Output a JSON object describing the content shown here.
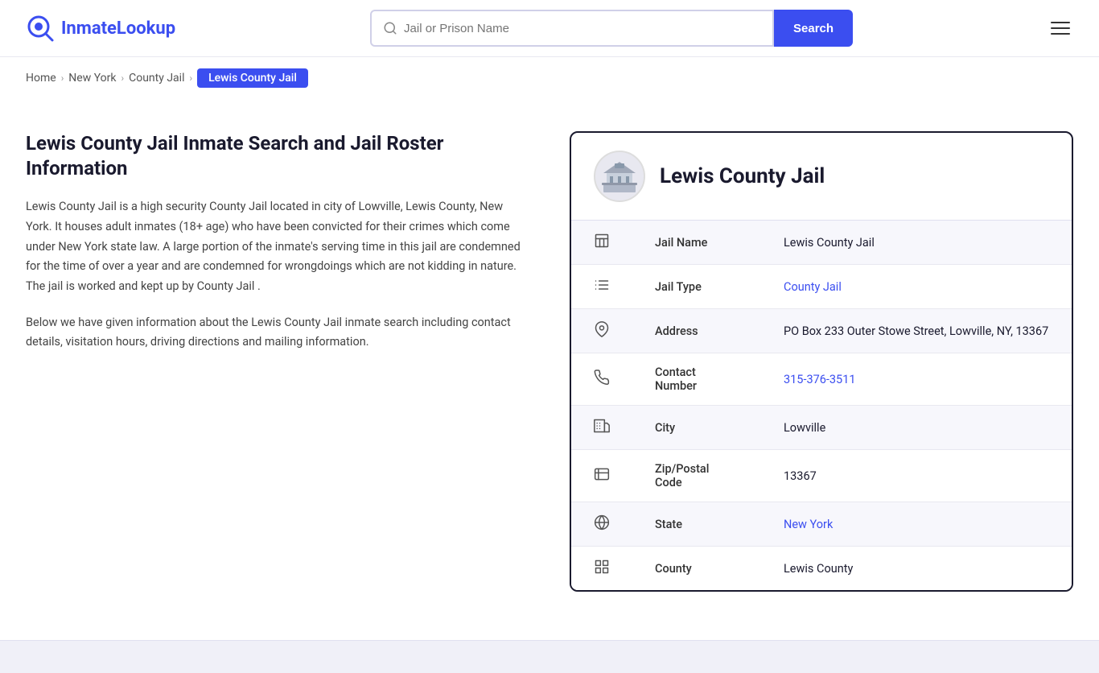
{
  "logo": {
    "prefix": "Inmate",
    "suffix": "Lookup"
  },
  "search": {
    "placeholder": "Jail or Prison Name",
    "button_label": "Search"
  },
  "breadcrumb": {
    "home": "Home",
    "state": "New York",
    "category": "County Jail",
    "current": "Lewis County Jail"
  },
  "left": {
    "title": "Lewis County Jail Inmate Search and Jail Roster Information",
    "description1": "Lewis County Jail is a high security County Jail located in city of Lowville, Lewis County, New York. It houses adult inmates (18+ age) who have been convicted for their crimes which come under New York state law. A large portion of the inmate's serving time in this jail are condemned for the time of over a year and are condemned for wrongdoings which are not kidding in nature. The jail is worked and kept up by County Jail .",
    "description2": "Below we have given information about the Lewis County Jail inmate search including contact details, visitation hours, driving directions and mailing information."
  },
  "card": {
    "title": "Lewis County Jail",
    "rows": [
      {
        "icon": "building-icon",
        "label": "Jail Name",
        "value": "Lewis County Jail",
        "link": null
      },
      {
        "icon": "list-icon",
        "label": "Jail Type",
        "value": "County Jail",
        "link": "#"
      },
      {
        "icon": "location-icon",
        "label": "Address",
        "value": "PO Box 233 Outer Stowe Street, Lowville, NY, 13367",
        "link": null
      },
      {
        "icon": "phone-icon",
        "label": "Contact Number",
        "value": "315-376-3511",
        "link": "tel:315-376-3511"
      },
      {
        "icon": "city-icon",
        "label": "City",
        "value": "Lowville",
        "link": null
      },
      {
        "icon": "zip-icon",
        "label": "Zip/Postal Code",
        "value": "13367",
        "link": null
      },
      {
        "icon": "state-icon",
        "label": "State",
        "value": "New York",
        "link": "#"
      },
      {
        "icon": "county-icon",
        "label": "County",
        "value": "Lewis County",
        "link": null
      }
    ]
  }
}
